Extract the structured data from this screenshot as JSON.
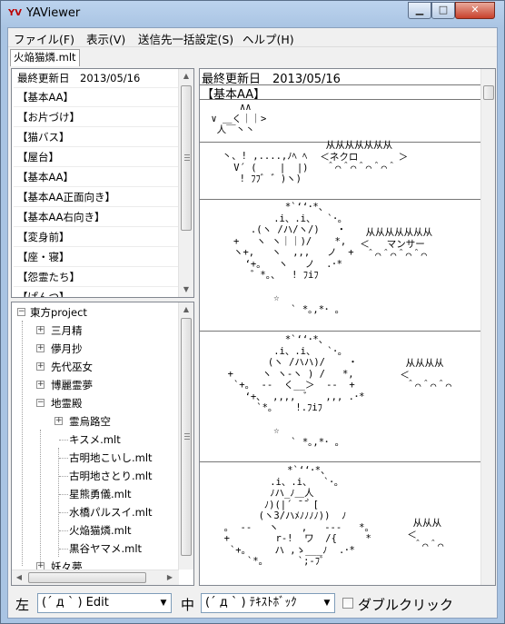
{
  "window": {
    "title": "YAViewer",
    "app_icon": "yaviewer-app-icon"
  },
  "menu": [
    "ファイル(F)",
    "表示(V)",
    "送信先一括設定(S)",
    "ヘルプ(H)"
  ],
  "tabs": [
    "火焔猫燐.mlt"
  ],
  "category_list": [
    "最終更新日　2013/05/16",
    "【基本AA】",
    "【お片づけ】",
    "【猫バス】",
    "【屋台】",
    "【基本AA】",
    "【基本AA正面向き】",
    "【基本AA右向き】",
    "【変身前】",
    "【座・寝】",
    "【怨霊たち】",
    "【ぱんつ】"
  ],
  "tree": {
    "root": "東方project",
    "items": [
      "三月精",
      "儚月抄",
      "先代巫女",
      "博麗霊夢",
      "地霊殿",
      "霊烏路空",
      "キスメ.mlt",
      "古明地こいし.mlt",
      "古明地さとり.mlt",
      "星熊勇儀.mlt",
      "水橋パルスイ.mlt",
      "火焔猫燐.mlt",
      "黒谷ヤマメ.mlt",
      "妖々夢"
    ]
  },
  "preview": {
    "header_date": "最終更新日　2013/05/16",
    "header_section": "【基本AA】",
    "aa": [
      "      ∧∧\n ∨ ＿く｜｜>\n  人￣丶丶",
      "  丶、! ,....,ﾉﾍ ﾍ\n    V´ (    |  |)\n     ! ﾌﾌﾞ ゛)ヽ)",
      "            *`‘‘･*、\n          .i、.i、  `･｡\n      .(ヽ /ハ/ヽ/)   ・\n   +   ヽ ヽ｜｜)/    *,\n   ヽ+,   ヽ  ,,,   ノ  +\n     ‘+｡   ヽ   ノ  .･*\n      ゛*｡、  ! ﾌiﾌ\n\n          ☆\n             ` *｡,*･ ｡",
      "            *`‘‘･*、\n          .i、.i、  `･｡\n         (ヽ /ハハ)/    ・\n  +     ヽ ヽ-ヽ ) /   *,\n   `+｡  --  く__＞  --  +\n     ‘+､  ,,,,  ﾞ   ,,, .･*\n       `*｡    !.ﾌiﾌ\n\n          ☆\n             ` *｡,*･ ｡",
      "             *`‘‘･*、\n          .i、.i、  `･｡\n          ﾉハ_ﾉ＿人\n         ﾉ)(|´ ̄ ̄｀[\n        (ヽ3/ハﾒﾉﾉﾉﾉ))  ﾉ\n  ｡  --   ヽ    ,   ---   *｡\n  +        r-!  ワ  /{     *\n   `+｡     ハ ,ゝ___ﾉ  .･*\n      `*｡      `;-ﾌﾞ"
    ],
    "balloons": [
      "  从从从从从从从\n ＜ネクロ       ＞\n  ＾⌒＾⌒＾⌒＾⌒＾",
      "  从从从从从从从\n ＜   マンサー\n  ＾⌒＾⌒＾⌒＾⌒",
      "  从从从从\n ＜\n  ＾⌒＾⌒＾⌒",
      "  从从从\n ＜\n  ＾⌒＾⌒"
    ]
  },
  "bottom": {
    "left_label": "左",
    "left_combo": "(´ д ` ) Edit",
    "middle_label": "中",
    "middle_combo": "(´ д ` ) ﾃｷｽﾄﾎﾞｯｸ",
    "double_click_label": "ダブルクリック",
    "double_click_checked": false
  }
}
